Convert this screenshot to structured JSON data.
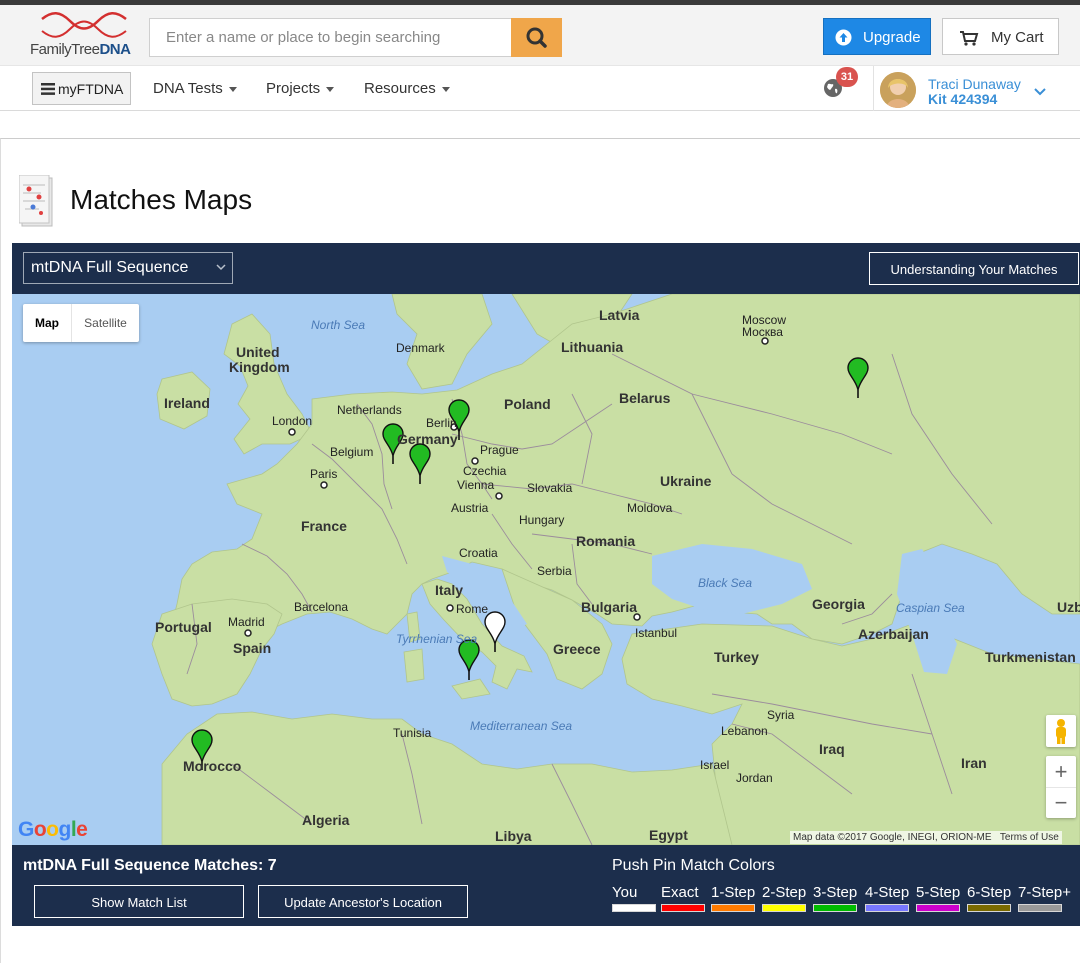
{
  "header": {
    "logo_text_a": "FamilyTree",
    "logo_text_b": "DNA",
    "search_placeholder": "Enter a name or place to begin searching",
    "upgrade_label": "Upgrade",
    "cart_label": "My Cart"
  },
  "nav": {
    "menu_label": "myFTDNA",
    "items": [
      "DNA Tests",
      "Projects",
      "Resources"
    ],
    "notification_count": "31",
    "user_name": "Traci Dunaway",
    "user_kit": "Kit 424394"
  },
  "page": {
    "title": "Matches Maps"
  },
  "map_panel": {
    "selected_test": "mtDNA Full Sequence",
    "understand_label": "Understanding Your Matches",
    "map_type_map": "Map",
    "map_type_satellite": "Satellite",
    "zoom_in": "+",
    "zoom_out": "−",
    "attribution": "Map data ©2017 Google, INEGI, ORION-ME",
    "terms": "Terms of Use",
    "labels": {
      "north_sea": "North Sea",
      "latvia": "Latvia",
      "moscow": "Moscow",
      "moscow_ru": "Москва",
      "lithuania": "Lithuania",
      "denmark": "Denmark",
      "united_kingdom_1": "United",
      "united_kingdom_2": "Kingdom",
      "ireland": "Ireland",
      "london": "London",
      "netherlands": "Netherlands",
      "berlin": "Berlin",
      "poland": "Poland",
      "belarus": "Belarus",
      "belgium": "Belgium",
      "germany": "Germany",
      "prague": "Prague",
      "paris": "Paris",
      "czechia": "Czechia",
      "ukraine": "Ukraine",
      "vienna": "Vienna",
      "slovakia": "Slovakia",
      "austria": "Austria",
      "moldova": "Moldova",
      "hungary": "Hungary",
      "france": "France",
      "romania": "Romania",
      "croatia": "Croatia",
      "serbia": "Serbia",
      "black_sea": "Black Sea",
      "italy": "Italy",
      "barcelona": "Barcelona",
      "rome": "Rome",
      "bulgaria": "Bulgaria",
      "georgia": "Georgia",
      "caspian_sea": "Caspian Sea",
      "uzbekistan": "Uzb",
      "portugal": "Portugal",
      "madrid": "Madrid",
      "istanbul": "Istanbul",
      "azerbaijan": "Azerbaijan",
      "spain": "Spain",
      "tyrrhenian_sea": "Tyrrhenian Sea",
      "greece": "Greece",
      "turkey": "Turkey",
      "turkmenistan": "Turkmenistan",
      "mediterranean_sea": "Mediterranean Sea",
      "syria": "Syria",
      "tunisia": "Tunisia",
      "lebanon": "Lebanon",
      "iraq": "Iraq",
      "morocco": "Morocco",
      "israel": "Israel",
      "jordan": "Jordan",
      "iran": "Iran",
      "algeria": "Algeria",
      "libya": "Libya",
      "egypt": "Egypt"
    }
  },
  "bottom": {
    "match_count_label": "mtDNA Full Sequence Matches: 7",
    "show_match_list": "Show Match List",
    "update_location": "Update Ancestor's Location",
    "legend_title": "Push Pin Match Colors",
    "legend": [
      {
        "label": "You",
        "color": "#ffffff"
      },
      {
        "label": "Exact",
        "color": "#ff0000"
      },
      {
        "label": "1-Step",
        "color": "#ff7a00"
      },
      {
        "label": "2-Step",
        "color": "#ffff00"
      },
      {
        "label": "3-Step",
        "color": "#00bb00"
      },
      {
        "label": "4-Step",
        "color": "#7777ff"
      },
      {
        "label": "5-Step",
        "color": "#cc00cc"
      },
      {
        "label": "6-Step",
        "color": "#7a6a00"
      },
      {
        "label": "7-Step+",
        "color": "#999999"
      }
    ]
  },
  "colors": {
    "panel_navy": "#1c2e4c",
    "accent_blue": "#1e88e5",
    "search_orange": "#f0a64a",
    "pin_green": "#22bb22"
  }
}
